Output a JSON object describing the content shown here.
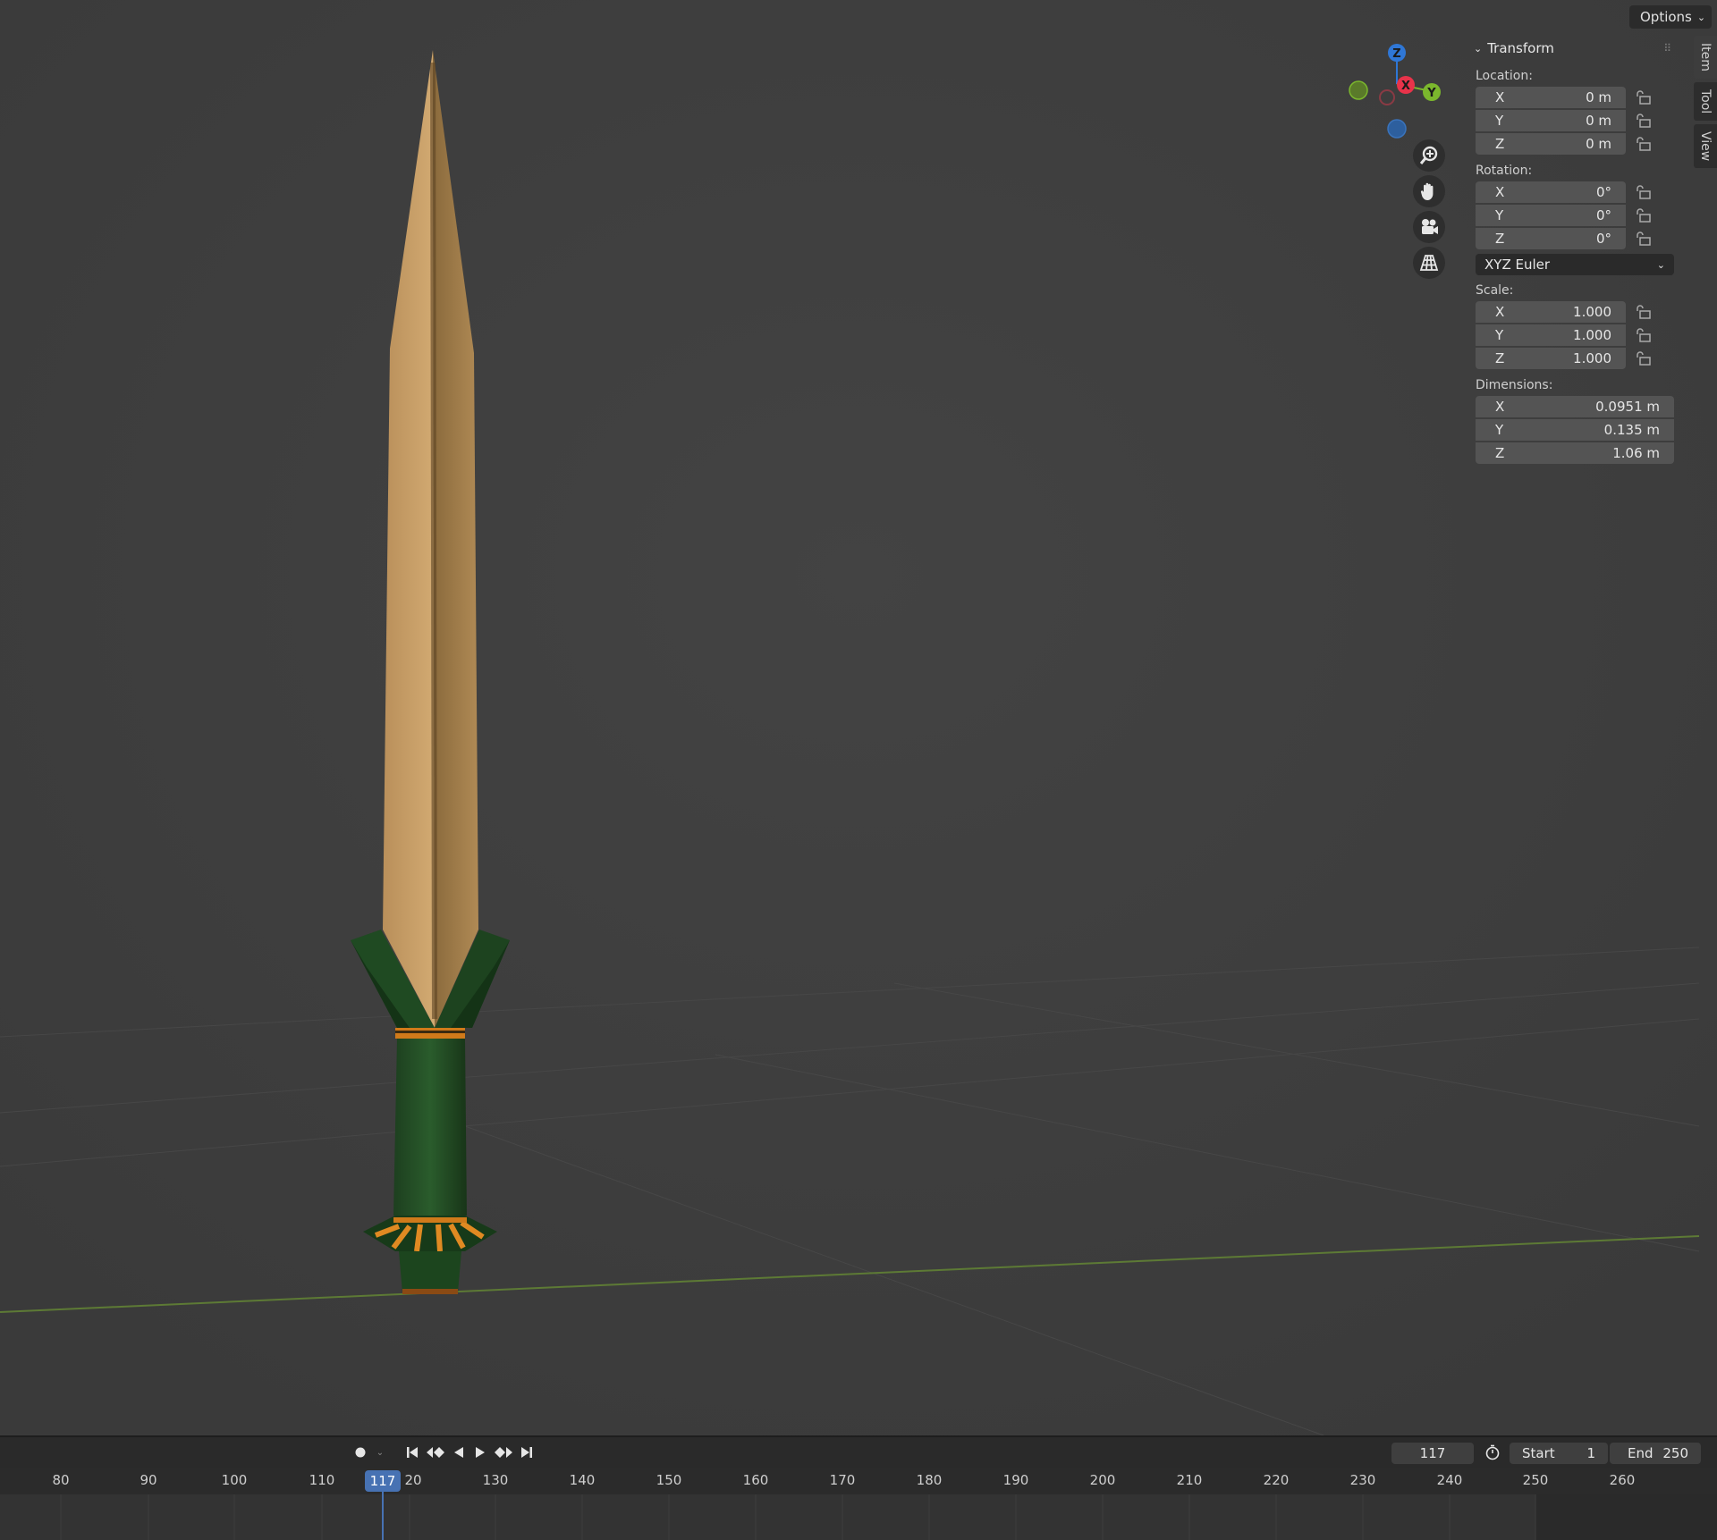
{
  "viewport": {
    "options_label": "Options"
  },
  "gizmo": {
    "x_label": "X",
    "y_label": "Y",
    "z_label": "Z",
    "colors": {
      "x": "#e8334a",
      "y": "#7bb72d",
      "z": "#2f77d6"
    }
  },
  "nav_icons": [
    "zoom-icon",
    "pan-hand-icon",
    "camera-icon",
    "perspective-grid-icon"
  ],
  "side_tabs": [
    "Item",
    "Tool",
    "View"
  ],
  "transform": {
    "title": "Transform",
    "location_label": "Location:",
    "location": [
      {
        "axis": "X",
        "value": "0 m"
      },
      {
        "axis": "Y",
        "value": "0 m"
      },
      {
        "axis": "Z",
        "value": "0 m"
      }
    ],
    "rotation_label": "Rotation:",
    "rotation": [
      {
        "axis": "X",
        "value": "0°"
      },
      {
        "axis": "Y",
        "value": "0°"
      },
      {
        "axis": "Z",
        "value": "0°"
      }
    ],
    "rotation_mode": "XYZ Euler",
    "scale_label": "Scale:",
    "scale": [
      {
        "axis": "X",
        "value": "1.000"
      },
      {
        "axis": "Y",
        "value": "1.000"
      },
      {
        "axis": "Z",
        "value": "1.000"
      }
    ],
    "dimensions_label": "Dimensions:",
    "dimensions": [
      {
        "axis": "X",
        "value": "0.0951 m"
      },
      {
        "axis": "Y",
        "value": "0.135 m"
      },
      {
        "axis": "Z",
        "value": "1.06 m"
      }
    ]
  },
  "timeline": {
    "current_frame": "117",
    "start_label": "Start",
    "start_value": "1",
    "end_label": "End",
    "end_value": "250",
    "ruler": [
      "80",
      "90",
      "100",
      "110",
      "117",
      "20",
      "130",
      "140",
      "150",
      "160",
      "170",
      "180",
      "190",
      "200",
      "210",
      "220",
      "230",
      "240",
      "250",
      "260"
    ],
    "accent": "#4772b3"
  }
}
